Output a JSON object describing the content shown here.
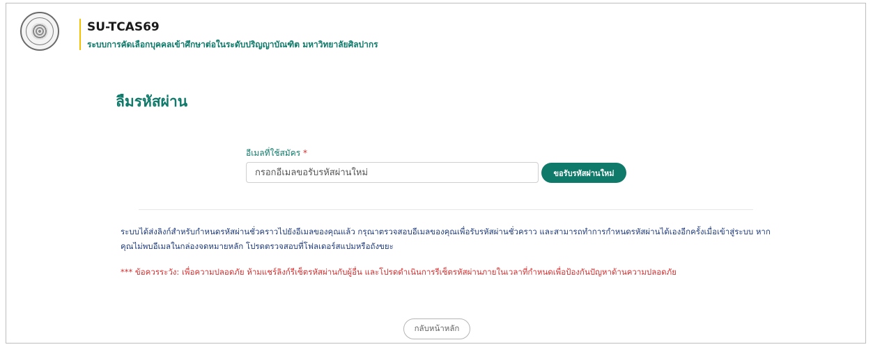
{
  "header": {
    "app_title": "SU-TCAS69",
    "app_subtitle": "ระบบการคัดเลือกบุคคลเข้าศึกษาต่อในระดับปริญญาบัณฑิต มหาวิทยาลัยศิลปากร",
    "logo_icon": "university-seal-icon"
  },
  "page": {
    "title": "ลืมรหัสผ่าน"
  },
  "form": {
    "email_label": "อีเมลที่ใช้สมัคร",
    "required_mark": "*",
    "email_value": "",
    "email_placeholder": "กรอกอีเมลขอรับรหัสผ่านใหม่",
    "submit_label": "ขอรับรหัสผ่านใหม่"
  },
  "messages": {
    "info": "ระบบได้ส่งลิงก์สำหรับกำหนดรหัสผ่านชั่วคราวไปยังอีเมลของคุณแล้ว กรุณาตรวจสอบอีเมลของคุณเพื่อรับรหัสผ่านชั่วคราว และสามารถทำการกำหนดรหัสผ่านได้เองอีกครั้งเมื่อเข้าสู่ระบบ หากคุณไม่พบอีเมลในกล่องจดหมายหลัก โปรดตรวจสอบที่โฟลเดอร์สแปมหรือถังขยะ",
    "warning": "*** ข้อควรระวัง: เพื่อความปลอดภัย ห้ามแชร์ลิงก์รีเซ็ตรหัสผ่านกับผู้อื่น และโปรดดำเนินการรีเซ็ตรหัสผ่านภายในเวลาที่กำหนดเพื่อป้องกันปัญหาด้านความปลอดภัย"
  },
  "footer": {
    "home_label": "กลับหน้าหลัก"
  },
  "colors": {
    "brand": "#0f7a6a",
    "accent_bar": "#f2c100",
    "info_text": "#1f3b7a",
    "warning_text": "#d32f2f"
  }
}
